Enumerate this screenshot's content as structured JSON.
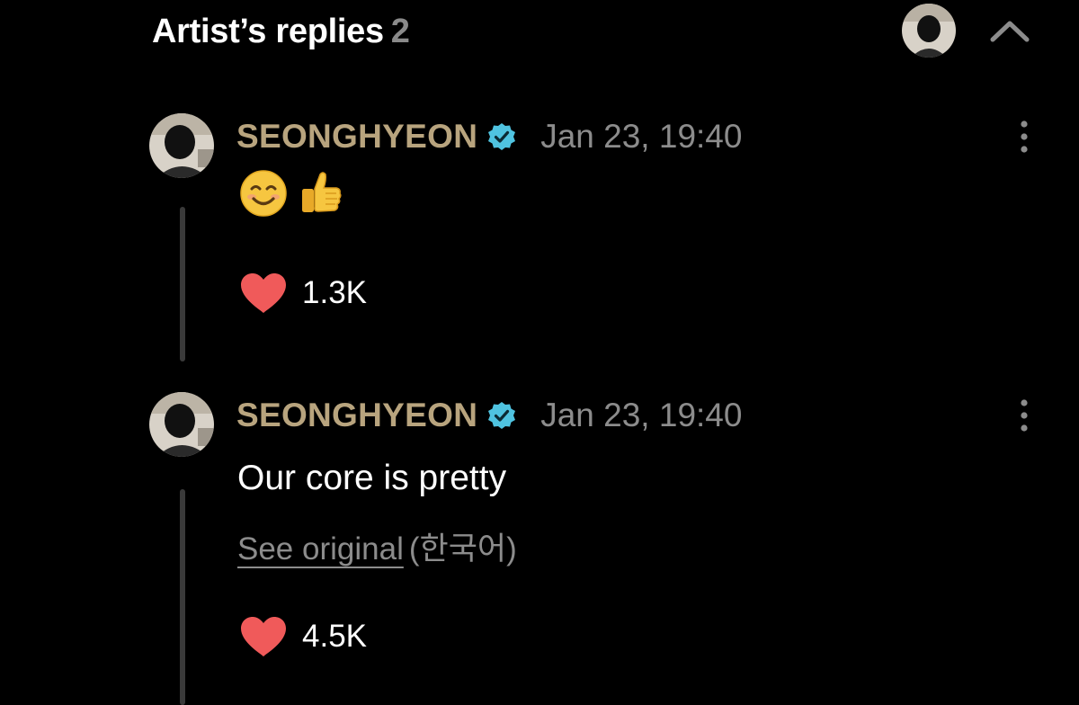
{
  "header": {
    "title": "Artist’s replies",
    "count": "2",
    "avatar_icon": "profile-avatar",
    "collapse_icon": "chevron-up-icon"
  },
  "replies": [
    {
      "author": "SEONGHYEON",
      "verified": true,
      "timestamp": "Jan 23, 19:40",
      "emojis": [
        "smiling-face-icon",
        "thumbs-up-icon"
      ],
      "likes": "1.3K"
    },
    {
      "author": "SEONGHYEON",
      "verified": true,
      "timestamp": "Jan 23, 19:40",
      "text": "Our core is pretty",
      "see_original_label": "See original",
      "original_language": "(한국어)",
      "likes": "4.5K"
    }
  ],
  "colors": {
    "background": "#000000",
    "author": "#b8a47e",
    "verified": "#4fc3e0",
    "heart": "#f05a5a",
    "muted": "#8c8c8c",
    "thread_line": "#3a3a3a"
  }
}
